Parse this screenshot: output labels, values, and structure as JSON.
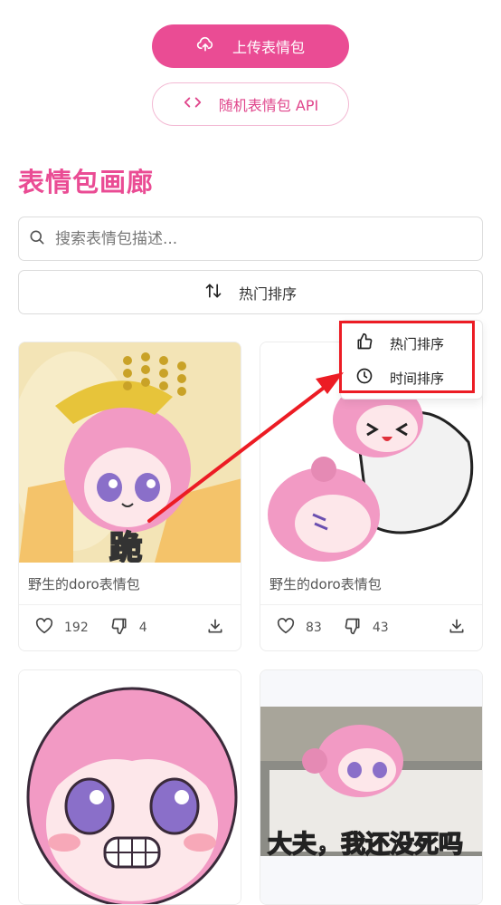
{
  "upload_button": {
    "label": "上传表情包",
    "icon": "cloud-upload-icon"
  },
  "api_button": {
    "label": "随机表情包 API",
    "icon": "code-icon"
  },
  "gallery_title": "表情包画廊",
  "search": {
    "placeholder": "搜索表情包描述...",
    "value": "",
    "icon": "search-icon"
  },
  "sort": {
    "label": "热门排序",
    "icon": "sort-arrows-icon"
  },
  "sort_menu": {
    "items": [
      {
        "label": "热门排序",
        "icon": "thumbs-up-icon"
      },
      {
        "label": "时间排序",
        "icon": "clock-icon"
      }
    ]
  },
  "cards": [
    {
      "caption": "野生的doro表情包",
      "likes": "192",
      "dislikes": "4",
      "image_text": "跪"
    },
    {
      "caption": "野生的doro表情包",
      "likes": "83",
      "dislikes": "43",
      "image_text": ""
    },
    {
      "caption": "",
      "likes": "",
      "dislikes": "",
      "image_text": ""
    },
    {
      "caption": "",
      "likes": "",
      "dislikes": "",
      "image_text": "大夫，我还没死吗"
    }
  ],
  "colors": {
    "accent": "#ea4c94",
    "annotation_red": "#ec1c24",
    "hair_pink": "#f29ac4",
    "eye_purple": "#8a6fc9"
  }
}
